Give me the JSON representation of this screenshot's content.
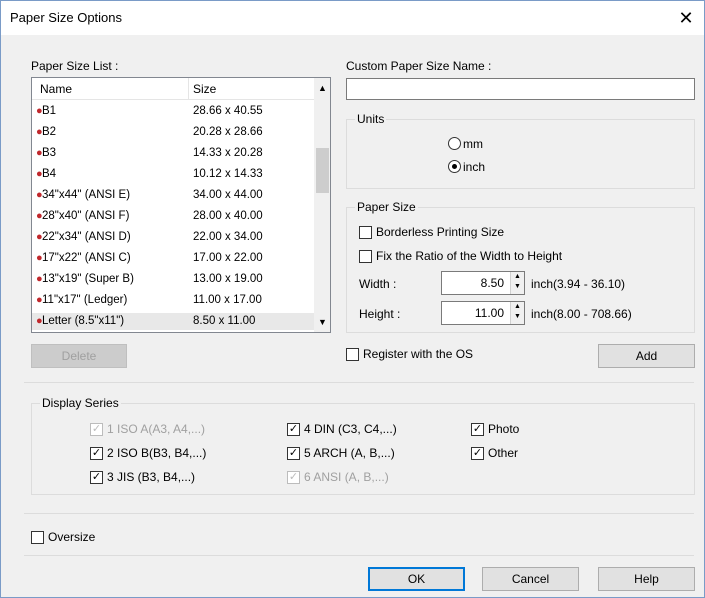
{
  "window": {
    "title": "Paper Size Options"
  },
  "paper_size_list": {
    "label": "Paper Size List :",
    "columns": [
      "Name",
      "Size"
    ],
    "rows": [
      {
        "name": "B1",
        "size": "28.66 x 40.55"
      },
      {
        "name": "B2",
        "size": "20.28 x 28.66"
      },
      {
        "name": "B3",
        "size": "14.33 x 20.28"
      },
      {
        "name": "B4",
        "size": "10.12 x 14.33"
      },
      {
        "name": "34\"x44\" (ANSI E)",
        "size": "34.00 x 44.00"
      },
      {
        "name": "28\"x40\" (ANSI F)",
        "size": "28.00 x 40.00"
      },
      {
        "name": "22\"x34\" (ANSI D)",
        "size": "22.00 x 34.00"
      },
      {
        "name": "17\"x22\" (ANSI C)",
        "size": "17.00 x 22.00"
      },
      {
        "name": "13\"x19\" (Super B)",
        "size": "13.00 x 19.00"
      },
      {
        "name": "11\"x17\" (Ledger)",
        "size": "11.00 x 17.00"
      },
      {
        "name": "Letter (8.5\"x11\")",
        "size": "8.50 x 11.00"
      }
    ],
    "delete_label": "Delete"
  },
  "custom_name": {
    "label": "Custom Paper Size Name :",
    "value": ""
  },
  "units": {
    "label": "Units",
    "options": [
      "mm",
      "inch"
    ],
    "selected": "inch"
  },
  "paper_size": {
    "label": "Paper Size",
    "borderless_label": "Borderless Printing Size",
    "fix_ratio_label": "Fix the Ratio of the Width to Height",
    "width_label": "Width :",
    "width_value": "8.50",
    "width_range": "inch(3.94 - 36.10)",
    "height_label": "Height :",
    "height_value": "11.00",
    "height_range": "inch(8.00 - 708.66)"
  },
  "register_label": "Register with the OS",
  "add_label": "Add",
  "display_series": {
    "label": "Display Series",
    "items": [
      {
        "label": "1 ISO A(A3, A4,...)",
        "checked": true,
        "disabled": true
      },
      {
        "label": "2 ISO B(B3, B4,...)",
        "checked": true,
        "disabled": false
      },
      {
        "label": "3 JIS (B3, B4,...)",
        "checked": true,
        "disabled": false
      },
      {
        "label": "4 DIN (C3, C4,...)",
        "checked": true,
        "disabled": false
      },
      {
        "label": "5 ARCH (A, B,...)",
        "checked": true,
        "disabled": false
      },
      {
        "label": "6 ANSI (A, B,...)",
        "checked": true,
        "disabled": true
      },
      {
        "label": "Photo",
        "checked": true,
        "disabled": false
      },
      {
        "label": "Other",
        "checked": true,
        "disabled": false
      }
    ]
  },
  "oversize_label": "Oversize",
  "buttons": {
    "ok": "OK",
    "cancel": "Cancel",
    "help": "Help"
  }
}
